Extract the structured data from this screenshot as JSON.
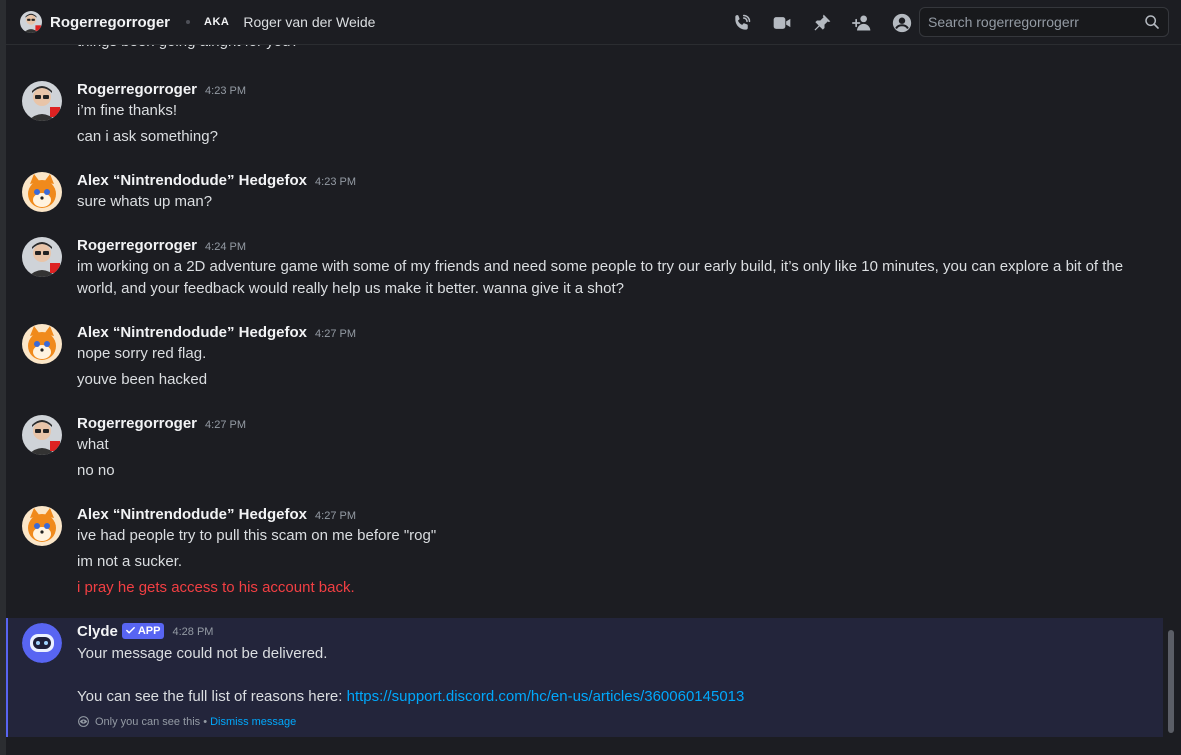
{
  "header": {
    "username": "Rogerregorroger",
    "aka_label": "AKA",
    "real_name": "Roger van der Weide",
    "search_placeholder": "Search rogerregorrogerr",
    "icons": [
      "phone-call-icon",
      "video-camera-icon",
      "pin-icon",
      "add-friend-icon",
      "profile-icon"
    ]
  },
  "partial_line": "things been going alright for you?",
  "messages": [
    {
      "author": "Rogerregorroger",
      "time": "4:23 PM",
      "lines": [
        "i’m fine thanks!",
        "can i ask something?"
      ]
    },
    {
      "author": "Alex “Nintrendodude” Hedgefox",
      "time": "4:23 PM",
      "lines": [
        "sure whats up man?"
      ]
    },
    {
      "author": "Rogerregorroger",
      "time": "4:24 PM",
      "lines": [
        "im working on a 2D adventure game with some of my friends and need some people to try our early build, it’s only like 10 minutes, you can explore a bit of the world, and your feedback would really help us make it better. wanna give it a shot?"
      ]
    },
    {
      "author": "Alex “Nintrendodude” Hedgefox",
      "time": "4:27 PM",
      "lines": [
        "nope sorry red flag.",
        "youve been hacked"
      ]
    },
    {
      "author": "Rogerregorroger",
      "time": "4:27 PM",
      "lines": [
        "what",
        "no no"
      ]
    },
    {
      "author": "Alex “Nintrendodude” Hedgefox",
      "time": "4:27 PM",
      "lines": [
        "ive had people try to pull this scam on me before \"rog\"",
        "im not a sucker.",
        "i pray he gets access to his account back."
      ]
    }
  ],
  "clyde": {
    "author": "Clyde",
    "badge": "APP",
    "time": "4:28 PM",
    "line1": "Your message could not be delivered.",
    "line2_prefix": "You can see the full list of reasons here: ",
    "link": "https://support.discord.com/hc/en-us/articles/360060145013",
    "only_you": "Only you can see this •",
    "dismiss": "Dismiss message"
  },
  "colors": {
    "background": "#1c1d22",
    "link": "#00a8fc",
    "error": "#f23f43",
    "brand": "#5865f2",
    "clyde_bg": "#23253b"
  }
}
